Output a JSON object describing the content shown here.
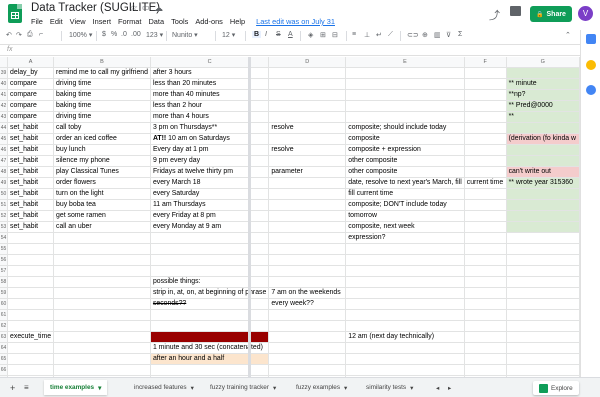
{
  "header": {
    "title": "Data Tracker (SUGILITE)",
    "menu": [
      "File",
      "Edit",
      "View",
      "Insert",
      "Format",
      "Data",
      "Tools",
      "Add-ons",
      "Help"
    ],
    "last_edit": "Last edit was on July 31",
    "share_label": "Share",
    "avatar_initial": "V"
  },
  "toolbar": {
    "zoom": "100%",
    "currency": "$",
    "percent": "%",
    "decimals_less": ".0",
    "decimals_more": ".00",
    "number_format": "123",
    "font": "Nunito",
    "font_size": "12",
    "bold": "B",
    "italic": "I",
    "strike": "S",
    "text_color": "A",
    "formula_label": "fx"
  },
  "columns": [
    "A",
    "B",
    "C",
    "D",
    "E",
    "F",
    "G"
  ],
  "rows": [
    {
      "n": "39",
      "a": "delay_by",
      "b": "remind me to call my girlfriend",
      "c": "after 3 hours",
      "d": "",
      "e": "",
      "f": "",
      "g": "",
      "g_style": "green"
    },
    {
      "n": "40",
      "a": "compare",
      "b": "driving time",
      "c": "less than 20 minutes",
      "d": "",
      "e": "",
      "f": "",
      "g": "** minute",
      "g_style": "green"
    },
    {
      "n": "41",
      "a": "compare",
      "b": "baking time",
      "c": "more than 40 minutes",
      "d": "",
      "e": "",
      "f": "",
      "g": "**np?",
      "g_style": "green"
    },
    {
      "n": "42",
      "a": "compare",
      "b": "baking time",
      "c": "less than 2 hour",
      "d": "",
      "e": "",
      "f": "",
      "g": "** Pred@0000",
      "g_style": "green"
    },
    {
      "n": "43",
      "a": "compare",
      "b": "driving time",
      "c": "more than 4 hours",
      "d": "",
      "e": "",
      "f": "",
      "g": "**",
      "g_style": "green"
    },
    {
      "n": "44",
      "a": "set_habit",
      "b": "call toby",
      "c": "3 pm on Thursdays**",
      "d": "resolve",
      "e": "composite; should include today",
      "f": "",
      "g": "",
      "g_style": "green"
    },
    {
      "n": "45",
      "a": "set_habit",
      "b": "order an iced coffee",
      "c_bold": "AT!!",
      "c": " 10 am on Saturdays",
      "d": "",
      "e": "composite",
      "f": "",
      "g": "(derivation (fo kinda w",
      "g_style": "pink"
    },
    {
      "n": "46",
      "a": "set_habit",
      "b": "buy lunch",
      "c": "Every day at 1 pm",
      "d": "resolve",
      "e": "composite + expression",
      "f": "",
      "g": "",
      "g_style": "green"
    },
    {
      "n": "47",
      "a": "set_habit",
      "b": "silence my phone",
      "c": "9 pm every day",
      "d": "",
      "e": "other composite",
      "f": "",
      "g": "",
      "g_style": "green"
    },
    {
      "n": "48",
      "a": "set_habit",
      "b": "play Classical Tunes",
      "c": "Fridays at twelve thirty pm",
      "d": "parameter",
      "e": "other composite",
      "f": "",
      "g": "can't write out",
      "g_style": "pink"
    },
    {
      "n": "49",
      "a": "set_habit",
      "b": "order flowers",
      "c": "every March 18",
      "d": "",
      "e": "date, resolve to next year's March, fill",
      "f": "current time",
      "g": "** wrote year  315360",
      "g_style": "green"
    },
    {
      "n": "50",
      "a": "set_habit",
      "b": "turn on the light",
      "c": "every Saturday",
      "d": "",
      "e": "fill current time",
      "f": "",
      "g": "",
      "g_style": "green"
    },
    {
      "n": "51",
      "a": "set_habit",
      "b": "buy boba tea",
      "c": "11 am Thursdays",
      "d": "",
      "e": "composite; DON'T include today",
      "f": "",
      "g": "",
      "g_style": "green"
    },
    {
      "n": "52",
      "a": "set_habit",
      "b": "get some ramen",
      "c": "every Friday at 8 pm",
      "d": "",
      "e": "tomorrow",
      "f": "",
      "g": "",
      "g_style": "green"
    },
    {
      "n": "53",
      "a": "set_habit",
      "b": "call an uber",
      "c": "every Monday at 9 am",
      "d": "",
      "e": "composite, next week",
      "f": "",
      "g": "",
      "g_style": "green"
    },
    {
      "n": "54",
      "a": "",
      "b": "",
      "c": "",
      "d": "",
      "e": "expression?",
      "f": "",
      "g": "",
      "g_style": ""
    },
    {
      "n": "55",
      "a": "",
      "b": "",
      "c": "",
      "d": "",
      "e": "",
      "f": "",
      "g": "",
      "g_style": ""
    },
    {
      "n": "56",
      "a": "",
      "b": "",
      "c": "",
      "d": "",
      "e": "",
      "f": "",
      "g": "",
      "g_style": ""
    },
    {
      "n": "57",
      "a": "",
      "b": "",
      "c": "",
      "d": "",
      "e": "",
      "f": "",
      "g": "",
      "g_style": ""
    },
    {
      "n": "58",
      "a": "",
      "b": "",
      "c": "possible things:",
      "d": "",
      "e": "",
      "f": "",
      "g": "",
      "g_style": ""
    },
    {
      "n": "59",
      "a": "",
      "b": "",
      "c": "strip in, at, on, at beginning of phrase",
      "d": "7 am on the weekends",
      "e": "",
      "f": "",
      "g": "",
      "g_style": ""
    },
    {
      "n": "60",
      "a": "",
      "b": "",
      "c": "seconds??",
      "c_style": "strike",
      "d": "every week??",
      "e": "",
      "f": "",
      "g": "",
      "g_style": ""
    },
    {
      "n": "61",
      "a": "",
      "b": "",
      "c": "",
      "d": "",
      "e": "",
      "f": "",
      "g": "",
      "g_style": ""
    },
    {
      "n": "62",
      "a": "",
      "b": "",
      "c": "",
      "d": "",
      "e": "",
      "f": "",
      "g": "",
      "g_style": ""
    },
    {
      "n": "63",
      "a": "execute_time",
      "b": "",
      "c": "",
      "c_style": "red",
      "d": "",
      "e": "12 am (next day technically)",
      "f": "",
      "g": "",
      "g_style": ""
    },
    {
      "n": "64",
      "a": "",
      "b": "",
      "c": "1 minute and 30 sec (concatenated)",
      "d": "",
      "e": "",
      "f": "",
      "g": "",
      "g_style": ""
    },
    {
      "n": "65",
      "a": "",
      "b": "",
      "c": "after an hour and a half",
      "c_style": "peach",
      "d": "",
      "e": "",
      "f": "",
      "g": "",
      "g_style": ""
    },
    {
      "n": "66",
      "a": "",
      "b": "",
      "c": "",
      "d": "",
      "e": "",
      "f": "",
      "g": "",
      "g_style": ""
    },
    {
      "n": "67",
      "a": "",
      "b": "",
      "c": "",
      "d": "",
      "e": "",
      "f": "",
      "g": "",
      "g_style": ""
    },
    {
      "n": "68",
      "a": "",
      "b": "",
      "c": "",
      "d": "",
      "e": "",
      "f": "",
      "g": "",
      "g_style": ""
    }
  ],
  "sheet_tabs": [
    "time examples",
    "increased features",
    "fuzzy training tracker",
    "fuzzy examples",
    "similarity tests"
  ],
  "explore_label": "Explore"
}
